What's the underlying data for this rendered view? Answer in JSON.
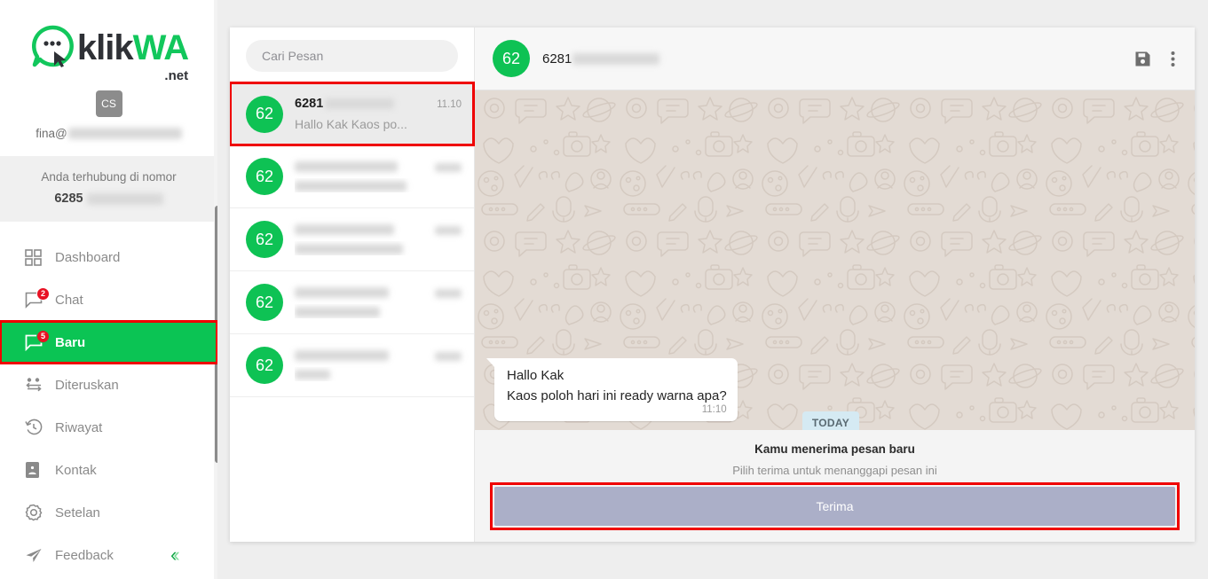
{
  "brand": {
    "name_dark": "klik",
    "name_green": "WA",
    "tld": ".net",
    "logo_icon": "chat-bubble-cursor-logo"
  },
  "account": {
    "avatar_initials": "CS",
    "email_prefix": "fina@",
    "email_redacted": true,
    "connected_label": "Anda terhubung di nomor",
    "connected_number_prefix": "6285",
    "connected_number_redacted": true
  },
  "sidebar": {
    "items": [
      {
        "label": "Dashboard",
        "icon": "grid-icon",
        "badge": "",
        "active": false
      },
      {
        "label": "Chat",
        "icon": "chat-bubble-icon",
        "badge": "2",
        "active": false
      },
      {
        "label": "Baru",
        "icon": "chat-bubble-icon",
        "badge": "5",
        "active": true
      },
      {
        "label": "Diteruskan",
        "icon": "users-transfer-icon",
        "badge": "",
        "active": false
      },
      {
        "label": "Riwayat",
        "icon": "history-clock-icon",
        "badge": "",
        "active": false
      },
      {
        "label": "Kontak",
        "icon": "contact-card-icon",
        "badge": "",
        "active": false
      },
      {
        "label": "Setelan",
        "icon": "gear-icon",
        "badge": "",
        "active": false
      },
      {
        "label": "Feedback",
        "icon": "paper-plane-icon",
        "badge": "",
        "active": false
      }
    ],
    "collapse_icon": "double-chevron-left-icon"
  },
  "chat_list": {
    "search_placeholder": "Cari Pesan",
    "search_value": "",
    "rows": [
      {
        "avatar": "62",
        "name": "6281",
        "name_redacted": true,
        "time": "11.10",
        "preview": "Hallo Kak Kaos po...",
        "preview_redacted": false,
        "selected": true
      },
      {
        "avatar": "62",
        "name": "",
        "name_redacted": true,
        "time": "",
        "preview": "",
        "preview_redacted": true,
        "selected": false
      },
      {
        "avatar": "62",
        "name": "",
        "name_redacted": true,
        "time": "",
        "preview": "",
        "preview_redacted": true,
        "selected": false
      },
      {
        "avatar": "62",
        "name": "",
        "name_redacted": true,
        "time": "",
        "preview": "",
        "preview_redacted": true,
        "selected": false
      },
      {
        "avatar": "62",
        "name": "",
        "name_redacted": true,
        "time": "",
        "preview": "",
        "preview_redacted": true,
        "selected": false
      }
    ]
  },
  "conversation": {
    "avatar": "62",
    "title": "6281",
    "title_redacted": true,
    "save_icon": "floppy-disk-save-icon",
    "menu_icon": "three-dots-vertical-icon",
    "date_divider": "TODAY",
    "messages": [
      {
        "line1": "Hallo Kak",
        "line2": "Kaos poloh hari ini ready warna apa?",
        "time": "11:10",
        "side": "incoming"
      }
    ]
  },
  "accept_panel": {
    "title": "Kamu menerima pesan baru",
    "subtitle": "Pilih terima untuk menanggapi pesan ini",
    "button_label": "Terima"
  },
  "colors": {
    "brand_green": "#0bc454",
    "avatar_green": "#0ec254",
    "highlight_red": "#ef0000",
    "badge_red": "#e81123",
    "accept_button": "#abafc8",
    "chat_wallpaper": "#e3dbd4",
    "date_chip": "#d5eaf3"
  }
}
